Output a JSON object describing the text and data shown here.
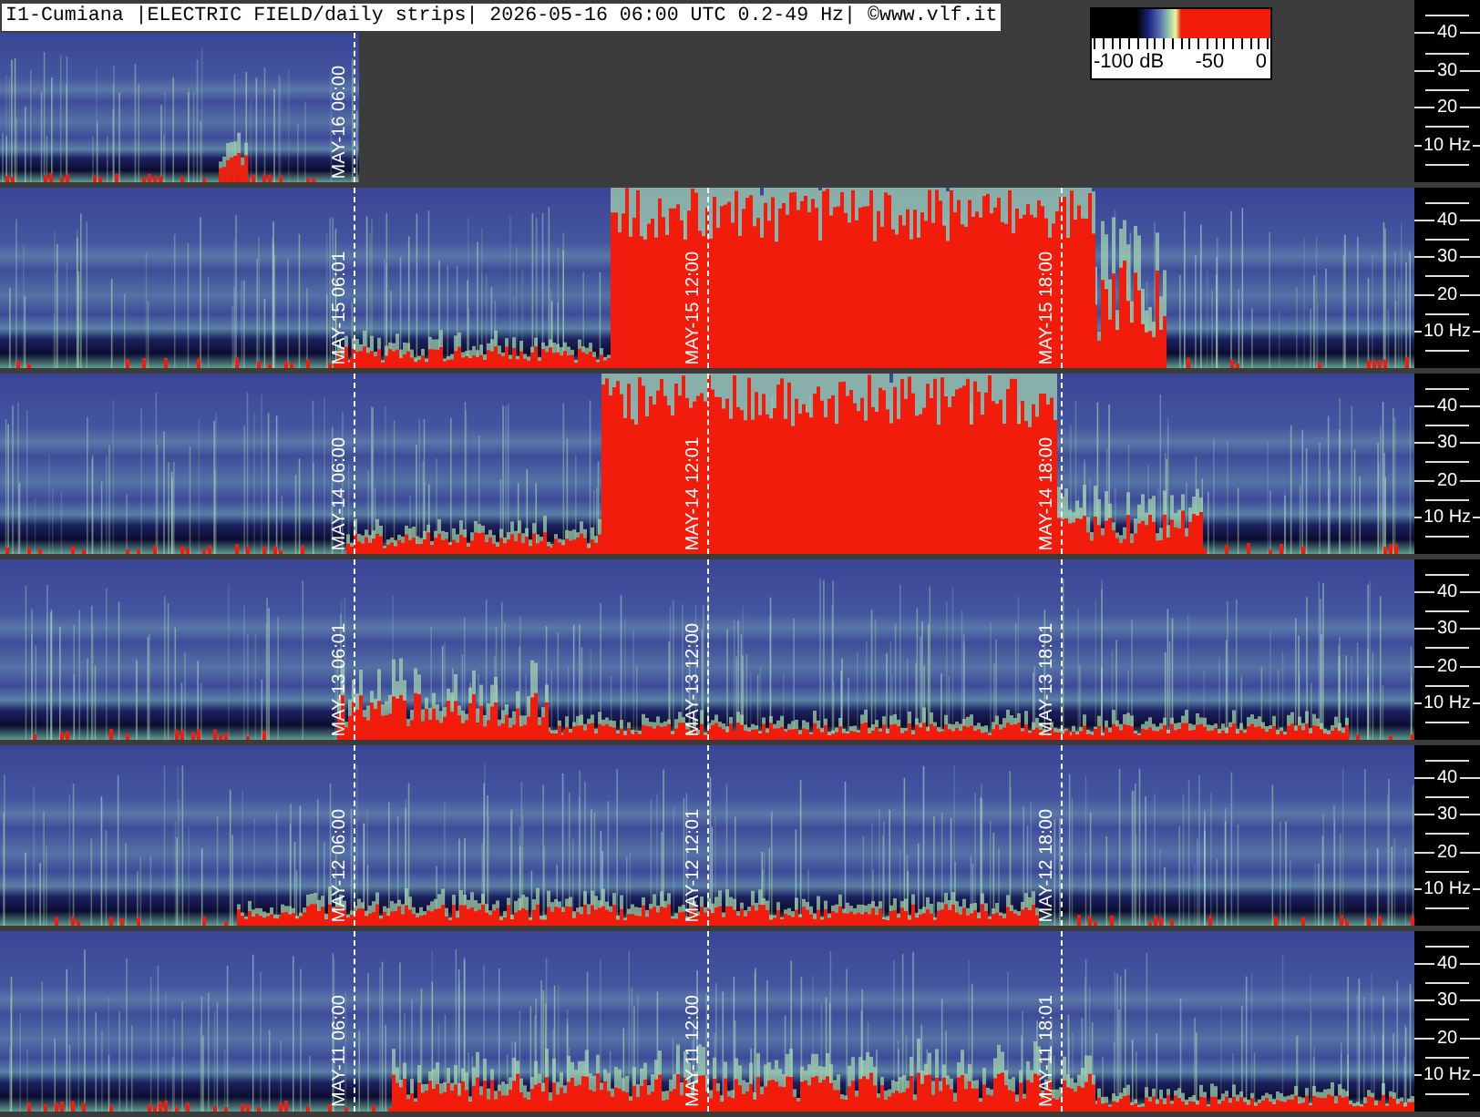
{
  "header": {
    "title": "I1-Cumiana |ELECTRIC FIELD/daily strips| 2026-05-16 06:00 UTC 0.2-49 Hz| ©www.vlf.it"
  },
  "colorbar": {
    "labels": [
      "-100 dB",
      "-50",
      "0"
    ]
  },
  "strips": [
    {
      "level": 0.254,
      "markers": [
        "MAY-16 06:00"
      ],
      "freq_axis": [
        "40",
        "30",
        "20",
        "10 Hz"
      ]
    },
    {
      "level": 1,
      "markers": [
        "MAY-15 06:01",
        "MAY-15 12:00",
        "MAY-15 18:00"
      ],
      "freq_axis": [
        "40",
        "30",
        "20",
        "10 Hz"
      ]
    },
    {
      "level": 1,
      "markers": [
        "MAY-14 06:00",
        "MAY-14 12:01",
        "MAY-14 18:00"
      ],
      "freq_axis": [
        "40",
        "30",
        "20",
        "10 Hz"
      ]
    },
    {
      "level": 1,
      "markers": [
        "MAY-13 06:01",
        "MAY-13 12:00",
        "MAY-13 18:01"
      ],
      "freq_axis": [
        "40",
        "30",
        "20",
        "10 Hz"
      ]
    },
    {
      "level": 1,
      "markers": [
        "MAY-12 06:00",
        "MAY-12 12:01",
        "MAY-12 18:00"
      ],
      "freq_axis": [
        "40",
        "30",
        "20",
        "10 Hz"
      ]
    },
    {
      "level": 1,
      "markers": [
        "MAY-11 06:00",
        "MAY-11 12:00",
        "MAY-11 18:01"
      ],
      "freq_axis": [
        "40",
        "30",
        "20",
        "10 Hz"
      ]
    }
  ]
}
